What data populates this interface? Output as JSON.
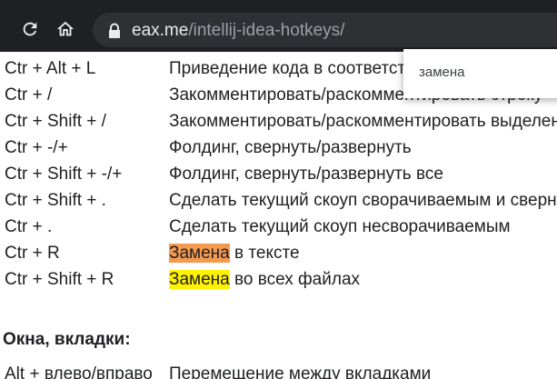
{
  "browser": {
    "url_host": "eax.me",
    "url_path": "/intellij-idea-hotkeys/"
  },
  "find_bar": {
    "query": "замена"
  },
  "shortcuts": [
    {
      "key": "Ctr + Alt + L",
      "desc": "Приведение кода в соответствие"
    },
    {
      "key": "Ctr + /",
      "desc": "Закомментировать/раскомментировать строку"
    },
    {
      "key": "Ctr + Shift + /",
      "desc": "Закомментировать/раскомментировать выделенное"
    },
    {
      "key": "Ctr + -/+",
      "desc": "Фолдинг, свернуть/развернуть"
    },
    {
      "key": "Ctr + Shift + -/+",
      "desc": "Фолдинг, свернуть/развернуть все"
    },
    {
      "key": "Ctr + Shift + .",
      "desc": "Сделать текущий скоуп сворачиваемым и свернуть"
    },
    {
      "key": "Ctr + .",
      "desc": "Сделать текущий скоуп несворачиваемым"
    },
    {
      "key": "Ctr + R",
      "desc_highlight": "Замена",
      "desc_rest": " в тексте"
    },
    {
      "key": "Ctr + Shift + R",
      "desc_highlight": "Замена",
      "desc_rest": " во всех файлах"
    }
  ],
  "section_title": "Окна, вкладки:",
  "next_row": {
    "key": "Alt + влево/вправо",
    "desc": "Перемещение между вкладками"
  }
}
